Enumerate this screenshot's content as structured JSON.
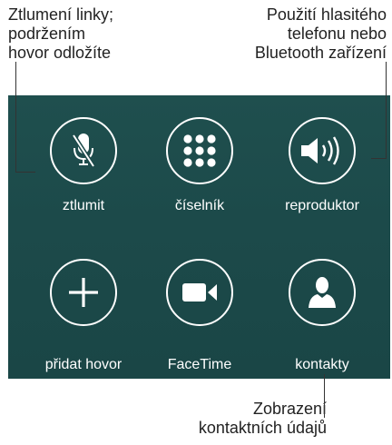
{
  "callouts": {
    "mute": "Ztlumení linky;\npodržením\nhovor odložíte",
    "speaker": "Použití hlasitého\ntelefonu nebo\nBluetooth zařízení",
    "contacts": "Zobrazení\nkontaktních údajů"
  },
  "buttons": [
    {
      "label": "ztlumit",
      "icon": "microphone-muted-icon"
    },
    {
      "label": "číselník",
      "icon": "keypad-icon"
    },
    {
      "label": "reproduktor",
      "icon": "speaker-icon"
    },
    {
      "label": "přidat hovor",
      "icon": "plus-icon"
    },
    {
      "label": "FaceTime",
      "icon": "video-camera-icon"
    },
    {
      "label": "kontakty",
      "icon": "person-icon"
    }
  ],
  "colors": {
    "panel_background": "#1c4a4a",
    "button_ring": "#ffffff",
    "callout_text": "#222222"
  }
}
